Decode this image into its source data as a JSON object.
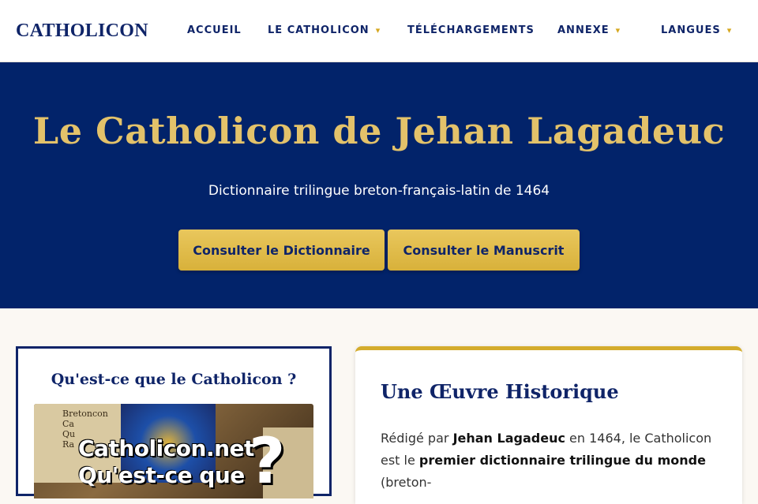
{
  "header": {
    "logo": "CATHOLICON",
    "nav": [
      {
        "label": "ACCUEIL",
        "dropdown": false
      },
      {
        "label": "LE CATHOLICON",
        "dropdown": true
      },
      {
        "label": "TÉLÉCHARGEMENTS",
        "dropdown": false
      },
      {
        "label": "ANNEXE",
        "dropdown": true
      },
      {
        "label": "LANGUES",
        "dropdown": true
      }
    ],
    "caret_glyph": "▾"
  },
  "hero": {
    "title": "Le Catholicon de Jehan Lagadeuc",
    "subtitle": "Dictionnaire trilingue breton-français-latin de 1464",
    "buttons": [
      {
        "label": "Consulter le Dictionnaire"
      },
      {
        "label": "Consulter le Manuscrit"
      }
    ]
  },
  "intro_card": {
    "title": "Qu'est-ce que le Catholicon ?",
    "video": {
      "caption_line1": "Catholicon.net",
      "caption_line2": "Qu'est-ce que",
      "mark": "?",
      "manuscript_text": "Bretoncon\nCa\nQu\nRa"
    }
  },
  "history_card": {
    "title": "Une Œuvre Historique",
    "paragraph": {
      "p1": "Rédigé par ",
      "author": "Jehan Lagadeuc",
      "p2": " en 1464, le Catholicon est le ",
      "highlight": "premier dictionnaire trilingue du monde",
      "p3": " (breton-"
    }
  },
  "colors": {
    "navy": "#02236a",
    "gold": "#e3c26a",
    "button_gold": "#d8b13a",
    "background": "#fbf8f3"
  }
}
